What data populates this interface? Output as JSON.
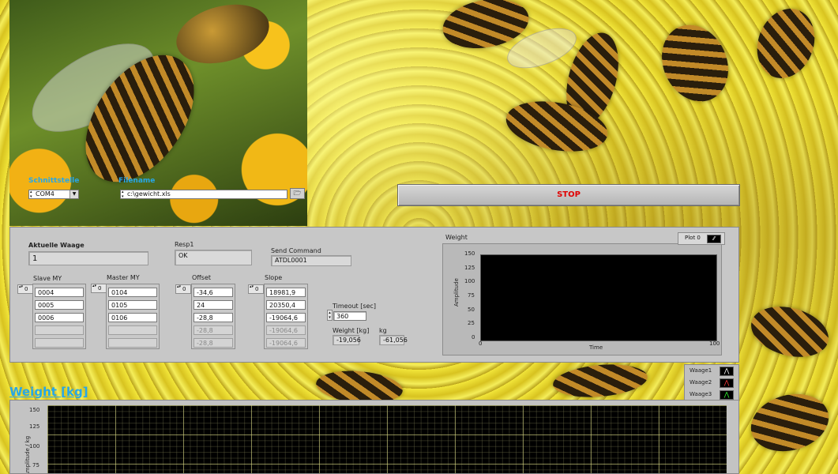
{
  "connection": {
    "port_label": "Schnittstelle",
    "port_value": "COM4",
    "file_label": "Filename",
    "file_value": "c:\\gewicht.xls"
  },
  "stop_label": "STOP",
  "status": {
    "current_scale_label": "Aktuelle Waage",
    "current_scale_value": "1",
    "resp_label": "Resp1",
    "resp_value": "OK",
    "send_label": "Send Command",
    "send_value": "ATDL0001"
  },
  "arrays": {
    "slave": {
      "label": "Slave MY",
      "index": "0",
      "values": [
        "0004",
        "0005",
        "0006",
        "",
        ""
      ]
    },
    "master": {
      "label": "Master MY",
      "index": "0",
      "values": [
        "0104",
        "0105",
        "0106",
        "",
        ""
      ]
    },
    "offset": {
      "label": "Offset",
      "index": "0",
      "values": [
        "-34,6",
        "24",
        "-28,8",
        "-28,8",
        "-28,8"
      ]
    },
    "slope": {
      "label": "Slope",
      "index": "0",
      "values": [
        "18981,9",
        "20350,4",
        "-19064,6",
        "-19064,6",
        "-19064,6"
      ]
    }
  },
  "timeout": {
    "label": "Timeout [sec]",
    "value": "360"
  },
  "weight": {
    "label": "Weight [kg]",
    "value": "-19,056",
    "kg_label": "kg",
    "kg_value": "-61,056"
  },
  "small_graph": {
    "title": "Weight",
    "legend": "Plot 0",
    "ylabel": "Amplitude",
    "xlabel": "Time",
    "yticks": [
      "150",
      "125",
      "100",
      "75",
      "50",
      "25",
      "0"
    ],
    "xticks": [
      "0",
      "100"
    ]
  },
  "big_graph": {
    "title": "Weight [kg]",
    "ylabel": "Amplitude / kg",
    "yticks": [
      "150",
      "125",
      "100",
      "75"
    ],
    "legend": [
      {
        "name": "Waage1",
        "color": "#ffffff"
      },
      {
        "name": "Waage2",
        "color": "#ff3b3b"
      },
      {
        "name": "Waage3",
        "color": "#33ff33"
      }
    ]
  }
}
